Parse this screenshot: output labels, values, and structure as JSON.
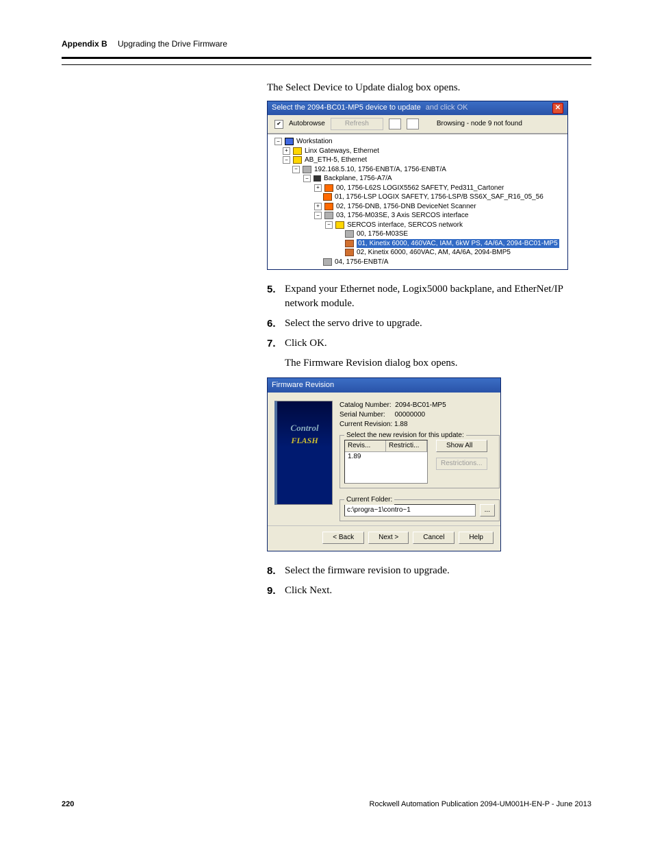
{
  "header": {
    "appendix": "Appendix B",
    "title": "Upgrading the Drive Firmware"
  },
  "intro1": "The Select Device to Update dialog box opens.",
  "dialog1": {
    "title_bold": "Select the 2094-BC01-MP5 device to update",
    "title_rest": " and click OK",
    "autobrowse": "Autobrowse",
    "refresh": "Refresh",
    "status": "Browsing - node 9 not found",
    "tree": {
      "n0": "Workstation",
      "n1": "Linx Gateways, Ethernet",
      "n2": "AB_ETH-5, Ethernet",
      "n3": "192.168.5.10, 1756-ENBT/A, 1756-ENBT/A",
      "n4": "Backplane, 1756-A7/A",
      "n5": "00, 1756-L62S LOGIX5562 SAFETY, Ped311_Cartoner",
      "n6": "01, 1756-LSP LOGIX SAFETY, 1756-LSP/B SS6X_SAF_R16_05_56",
      "n7": "02, 1756-DNB, 1756-DNB DeviceNet Scanner",
      "n8": "03, 1756-M03SE, 3 Axis SERCOS interface",
      "n9": "SERCOS interface, SERCOS network",
      "n10": "00, 1756-M03SE",
      "n11": "01, Kinetix 6000, 460VAC, IAM, 6kW PS, 4A/6A, 2094-BC01-MP5",
      "n12": "02, Kinetix 6000, 460VAC, AM, 4A/6A, 2094-BMP5",
      "n13": "04, 1756-ENBT/A"
    }
  },
  "step5": "Expand your Ethernet node, Logix5000 backplane, and EtherNet/IP network module.",
  "step6": "Select the servo drive to upgrade.",
  "step7": "Click OK.",
  "intro2": "The Firmware Revision dialog box opens.",
  "dialog2": {
    "title": "Firmware Revision",
    "catalog_lbl": "Catalog Number:",
    "catalog": "2094-BC01-MP5",
    "serial_lbl": "Serial Number:",
    "serial": "00000000",
    "currev_lbl": "Current Revision:",
    "currev": "1.88",
    "group_lbl": "Select the new revision for this update:",
    "col_rev": "Revis...",
    "col_res": "Restricti...",
    "row_rev": "1.89",
    "showall": "Show All",
    "restrictions": "Restrictions...",
    "folder_lbl": "Current Folder:",
    "folder": "c:\\progra~1\\contro~1",
    "browse": "...",
    "back": "< Back",
    "next": "Next >",
    "cancel": "Cancel",
    "help": "Help",
    "cf1": "Control",
    "cf2": "FLASH"
  },
  "step8": "Select the firmware revision to upgrade.",
  "step9": "Click Next.",
  "footer": {
    "page": "220",
    "pub": "Rockwell Automation Publication 2094-UM001H-EN-P - June 2013"
  }
}
